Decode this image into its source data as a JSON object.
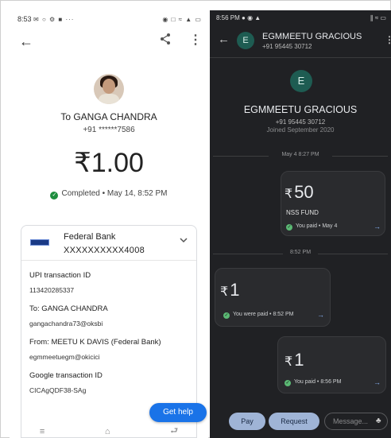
{
  "left": {
    "status": {
      "time": "8:53",
      "icons_left": "✉ ○ ⚙ ■ ···",
      "icons_right": "◉ □ ≈ ▲ ▭"
    },
    "header": {
      "back_icon": "←",
      "share_icon": "<",
      "more_icon": "⋮"
    },
    "recipient": {
      "to_label": "To GANGA CHANDRA",
      "phone": "+91 ******7586"
    },
    "amount": "₹1.00",
    "status_line": "Completed • May 14, 8:52 PM",
    "bank": {
      "name": "Federal Bank",
      "account": "XXXXXXXXXX4008"
    },
    "details": [
      {
        "label": "UPI transaction ID",
        "value": "113420285337"
      },
      {
        "label": "To: GANGA  CHANDRA",
        "value": "gangachandra73@oksbi"
      },
      {
        "label": "From: MEETU K DAVIS (Federal Bank)",
        "value": "egmmeetuegm@okicici"
      },
      {
        "label": "Google transaction ID",
        "value": "CICAgQDF38-SAg"
      }
    ],
    "help_button": "Get help",
    "nav": {
      "recents": "≡",
      "home": "⌂",
      "back": "⮐"
    }
  },
  "right": {
    "status": {
      "time": "8:56 PM",
      "icons_left": "● ◉ ▲",
      "icons_right": "∥ ≈ ▭"
    },
    "header": {
      "back_icon": "←",
      "avatar_letter": "E",
      "name": "EGMMEETU GRACIOUS",
      "phone": "+91 95445 30712",
      "more_icon": "⋮"
    },
    "profile": {
      "avatar_letter": "E",
      "name": "EGMMEETU GRACIOUS",
      "phone": "+91 95445 30712",
      "joined": "Joined September 2020"
    },
    "separators": [
      "May 4 8:27 PM",
      "8:52 PM"
    ],
    "messages": [
      {
        "amount": "50",
        "note": "NSS FUND",
        "status": "You paid • May 4"
      },
      {
        "amount": "1",
        "note": "",
        "status": "You were paid • 8:52 PM"
      },
      {
        "amount": "1",
        "note": "",
        "status": "You paid • 8:56 PM"
      }
    ],
    "currency": "₹",
    "bottom": {
      "pay": "Pay",
      "request": "Request",
      "message_placeholder": "Message...",
      "gift_icon": "♣"
    }
  }
}
